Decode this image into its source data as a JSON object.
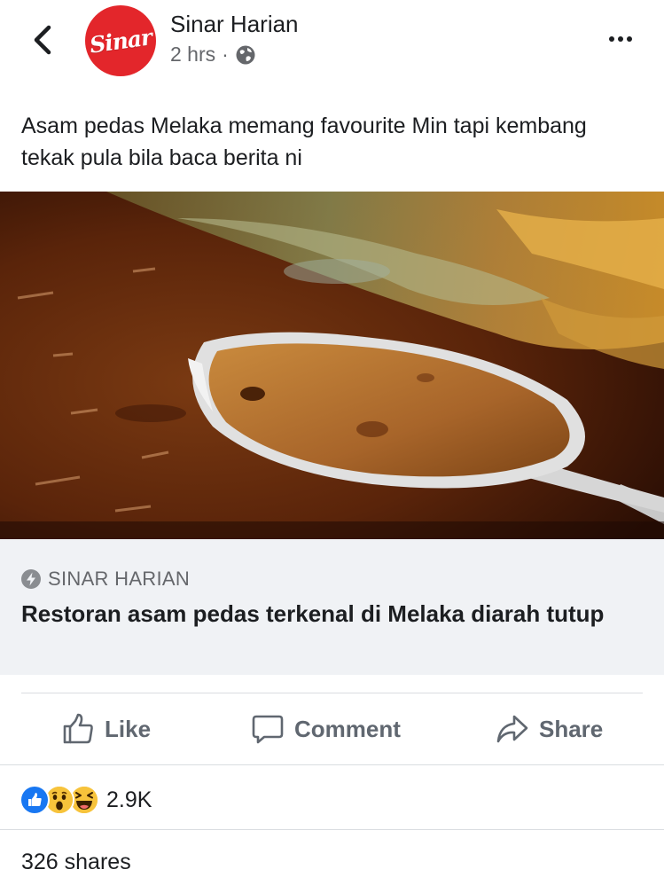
{
  "post": {
    "page_name": "Sinar Harian",
    "time": "2 hrs",
    "separator": "·",
    "privacy_icon": "globe-icon",
    "avatar_text": "Sinar",
    "caption": "Asam pedas Melaka memang favourite Min tapi kembang tekak pula bila baca berita ni"
  },
  "link": {
    "source_icon": "bolt-icon",
    "source": "SINAR HARIAN",
    "title": "Restoran asam pedas terkenal di Melaka diarah tutup"
  },
  "actions": {
    "like_label": "Like",
    "comment_label": "Comment",
    "share_label": "Share"
  },
  "stats": {
    "reaction_icons": [
      "like-reaction-icon",
      "wow-reaction-icon",
      "haha-reaction-icon"
    ],
    "reaction_count": "2.9K",
    "shares": "326 shares"
  },
  "colors": {
    "brand_red": "#e3262b",
    "like_blue": "#1877f2",
    "reaction_yellow": "#f7c33b",
    "link_bg": "#f0f2f5",
    "muted_text": "#65676b",
    "action_text": "#606770"
  }
}
